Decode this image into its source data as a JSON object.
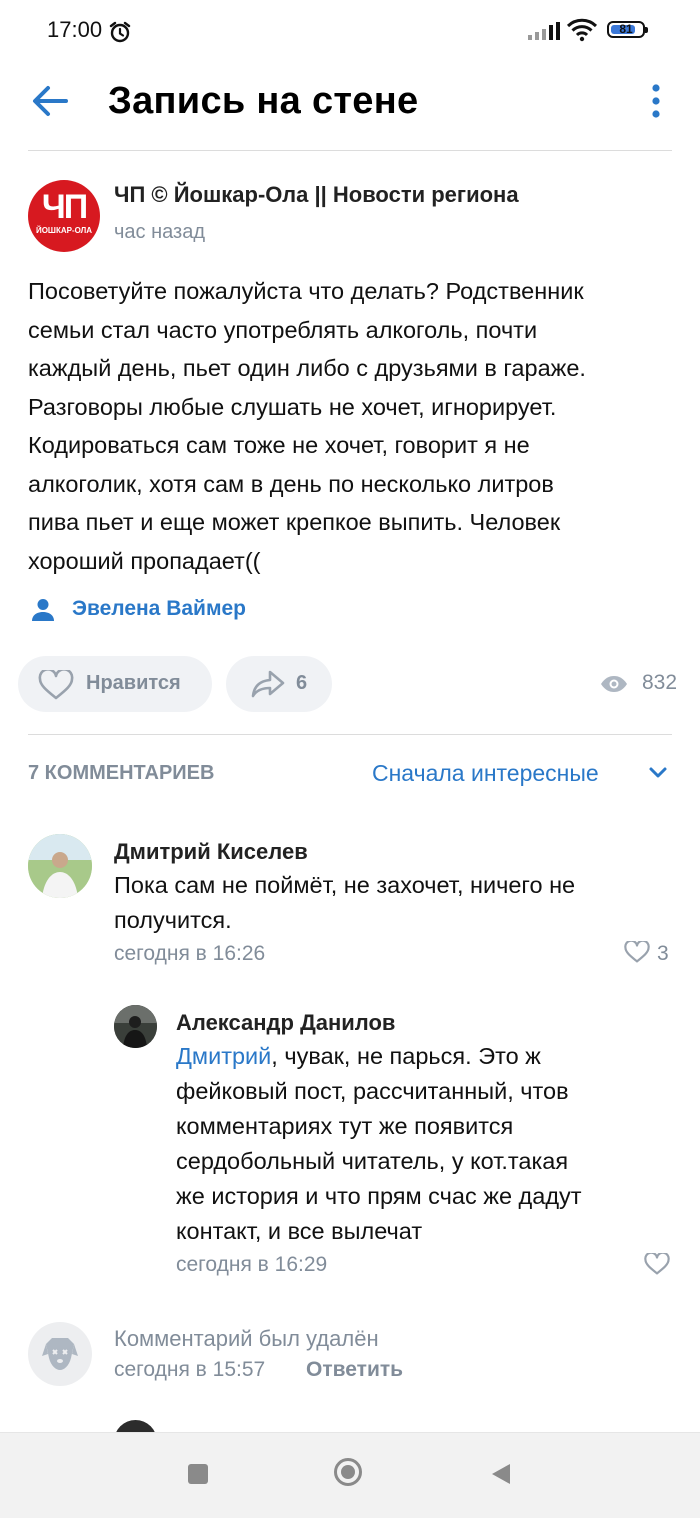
{
  "status_bar": {
    "time": "17:00",
    "battery": "81",
    "battery_level": 0.81
  },
  "header": {
    "title": "Запись на стене"
  },
  "post": {
    "logo_text": "ЧП",
    "logo_city": "ЙОШКАР-ОЛА",
    "group_name": "ЧП © Йошкар-Ола || Новости региона",
    "time": "час назад",
    "text_lines": [
      "Посоветуйте пожалуйста что делать? Родственник",
      "семьи стал часто употреблять алкоголь, почти",
      "каждый день, пьет один либо с друзьями в гараже.",
      "Разговоры любые слушать не хочет, игнорирует.",
      "Кодироваться сам тоже не хочет, говорит я не",
      "алкоголик, хотя сам в день по несколько литров",
      "пива пьет и еще может крепкое выпить. Человек",
      "хороший пропадает(("
    ],
    "author": "Эвелена Ваймер",
    "like_label": "Нравится",
    "share_count": "6",
    "views": "832"
  },
  "comments_section": {
    "count_label": "7 КОММЕНТАРИЕВ",
    "sort_label": "Сначала интересные"
  },
  "comments": [
    {
      "name": "Дмитрий Киселев",
      "text_lines": [
        "Пока сам не поймёт, не захочет, ничего не",
        "получится."
      ],
      "time": "сегодня в 16:26",
      "likes": "3"
    },
    {
      "name": "Александр Данилов",
      "mention": "Дмитрий",
      "text_first_rest": ", чувак, не парься. Это ж",
      "text_lines": [
        "фейковый пост, рассчитанный, чтов",
        "комментариях тут же появится",
        "сердобольный читатель, у кот.такая",
        "же история и что прям счас же дадут",
        "контакт, и все вылечат"
      ],
      "time": "сегодня в 16:29"
    },
    {
      "text": "Комментарий был удалён",
      "time": "сегодня в 15:57",
      "reply_label": "Ответить"
    }
  ],
  "colors": {
    "accent": "#2a78c8",
    "muted": "#818c99",
    "logo_red": "#d71920"
  },
  "icons": [
    "back-arrow-icon",
    "more-vertical-icon",
    "copyright-icon",
    "user-icon",
    "heart-icon",
    "share-icon",
    "eye-icon",
    "chevron-down-icon",
    "deleted-dog-icon"
  ]
}
